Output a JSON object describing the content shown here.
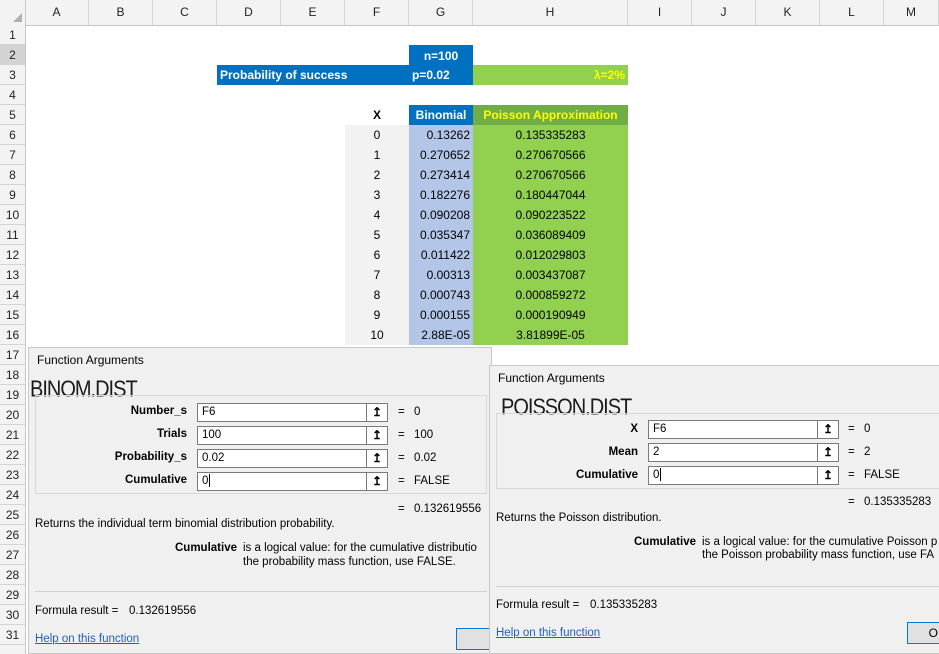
{
  "columns": [
    "A",
    "B",
    "C",
    "D",
    "E",
    "F",
    "G",
    "H",
    "I",
    "J",
    "K",
    "L",
    "M"
  ],
  "rows": [
    "1",
    "2",
    "3",
    "4",
    "5",
    "6",
    "7",
    "8",
    "9",
    "10",
    "11",
    "12",
    "13",
    "14",
    "15",
    "16",
    "17",
    "18",
    "19",
    "20",
    "21",
    "22",
    "23",
    "24",
    "25",
    "26",
    "27",
    "28",
    "29",
    "30",
    "31"
  ],
  "sheet": {
    "n_label": "n=100",
    "prob_label": "Probability of success",
    "p_label": "p=0.02",
    "lambda_label": "λ=2%",
    "header_x": "X",
    "header_binomial": "Binomial",
    "header_poisson": "Poisson Approximation",
    "table": [
      {
        "x": "0",
        "binomial": "0.13262",
        "poisson": "0.135335283"
      },
      {
        "x": "1",
        "binomial": "0.270652",
        "poisson": "0.270670566"
      },
      {
        "x": "2",
        "binomial": "0.273414",
        "poisson": "0.270670566"
      },
      {
        "x": "3",
        "binomial": "0.182276",
        "poisson": "0.180447044"
      },
      {
        "x": "4",
        "binomial": "0.090208",
        "poisson": "0.090223522"
      },
      {
        "x": "5",
        "binomial": "0.035347",
        "poisson": "0.036089409"
      },
      {
        "x": "6",
        "binomial": "0.011422",
        "poisson": "0.012029803"
      },
      {
        "x": "7",
        "binomial": "0.00313",
        "poisson": "0.003437087"
      },
      {
        "x": "8",
        "binomial": "0.000743",
        "poisson": "0.000859272"
      },
      {
        "x": "9",
        "binomial": "0.000155",
        "poisson": "0.000190949"
      },
      {
        "x": "10",
        "binomial": "2.88E-05",
        "poisson": "3.81899E-05"
      }
    ]
  },
  "binom_dialog": {
    "title": "Function Arguments",
    "function_name": "BINOM.DIST",
    "args": [
      {
        "label": "Number_s",
        "value": "F6",
        "result": "0"
      },
      {
        "label": "Trials",
        "value": "100",
        "result": "100"
      },
      {
        "label": "Probability_s",
        "value": "0.02",
        "result": "0.02"
      },
      {
        "label": "Cumulative",
        "value": "0",
        "result": "FALSE"
      }
    ],
    "total_result": "0.132619556",
    "description": "Returns the individual term binomial distribution probability.",
    "arg_help_name": "Cumulative",
    "arg_help_line1": "is a logical value: for the cumulative distributio",
    "arg_help_line2": "the probability mass function, use FALSE.",
    "formula_result_label": "Formula result =",
    "formula_result_value": "0.132619556",
    "help_link": "Help on this function",
    "equals": "="
  },
  "poisson_dialog": {
    "title": "Function Arguments",
    "function_name": "POISSON.DIST",
    "args": [
      {
        "label": "X",
        "value": "F6",
        "result": "0"
      },
      {
        "label": "Mean",
        "value": "2",
        "result": "2"
      },
      {
        "label": "Cumulative",
        "value": "0",
        "result": "FALSE"
      }
    ],
    "total_result": "0.135335283",
    "description": "Returns the Poisson distribution.",
    "arg_help_name": "Cumulative",
    "arg_help_line1": "is a logical value: for the cumulative Poisson p",
    "arg_help_line2": "the Poisson probability mass function, use FA",
    "formula_result_label": "Formula result =",
    "formula_result_value": "0.135335283",
    "help_link": "Help on this function",
    "ok_label": "O",
    "equals": "="
  },
  "icons": {
    "collapse": "collapse-dialog-icon"
  },
  "colors": {
    "blue": "#0070c0",
    "green": "#92d050",
    "light_blue": "#b4c6e7",
    "yellow_text": "#ffff00"
  }
}
